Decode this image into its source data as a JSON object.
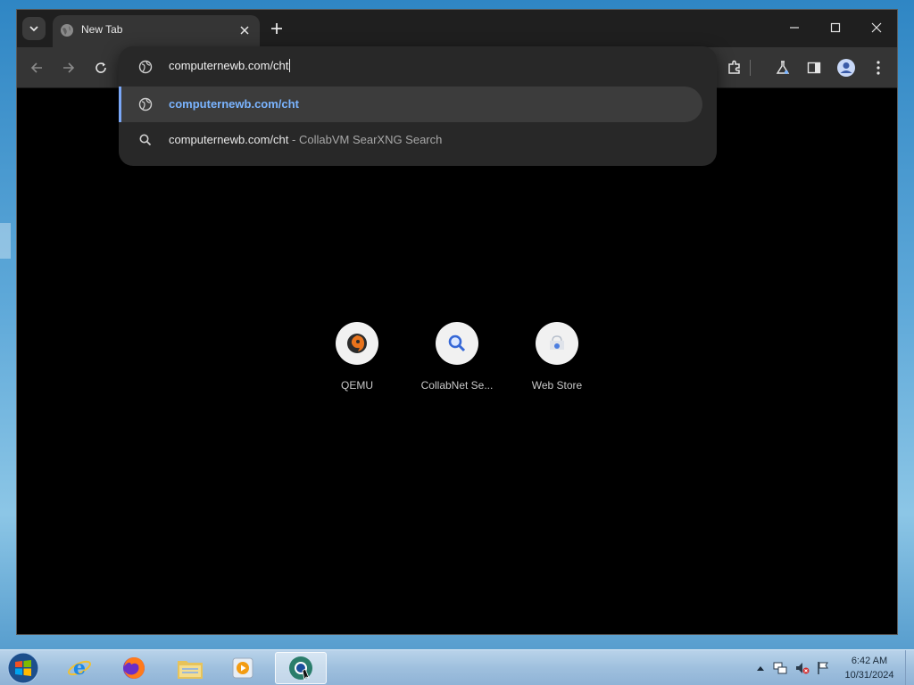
{
  "browser": {
    "tab": {
      "title": "New Tab"
    },
    "omnibox": {
      "value": "computernewb.com/cht",
      "suggestions": [
        {
          "text": "computernewb.com/cht",
          "description": "",
          "selected": true
        },
        {
          "text": "computernewb.com/cht",
          "description": "- CollabVM SearXNG Search",
          "selected": false
        }
      ]
    },
    "shortcuts": [
      {
        "label": "QEMU",
        "icon": "qemu-icon"
      },
      {
        "label": "CollabNet Se...",
        "icon": "search-magnifier-icon"
      },
      {
        "label": "Web Store",
        "icon": "web-store-icon"
      }
    ]
  },
  "taskbar": {
    "apps": [
      "internet-explorer-icon",
      "firefox-icon",
      "file-explorer-icon",
      "media-player-icon",
      "chrome-icon"
    ],
    "clock": {
      "time": "6:42 AM",
      "date": "10/31/2024"
    }
  },
  "colors": {
    "accent": "#7ab4ff",
    "window_bg": "#000000",
    "toolbar_bg": "#353535"
  }
}
